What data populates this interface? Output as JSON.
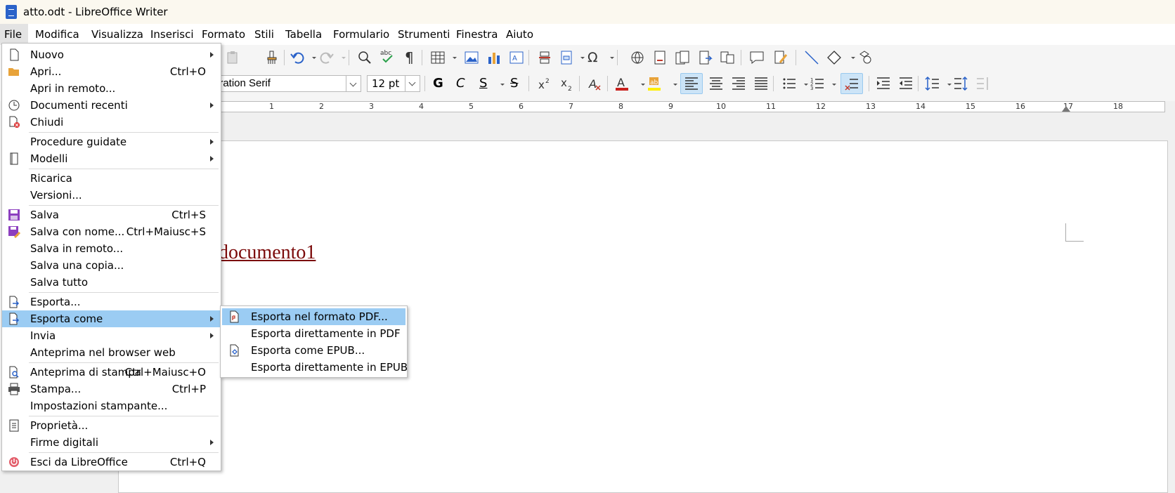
{
  "window": {
    "title": "atto.odt - LibreOffice Writer"
  },
  "menubar": [
    {
      "label": "File",
      "active": true
    },
    {
      "label": "Modifica"
    },
    {
      "label": "Visualizza"
    },
    {
      "label": "Inserisci"
    },
    {
      "label": "Formato"
    },
    {
      "label": "Stili"
    },
    {
      "label": "Tabella"
    },
    {
      "label": "Formulario"
    },
    {
      "label": "Strumenti"
    },
    {
      "label": "Finestra"
    },
    {
      "label": "Aiuto"
    }
  ],
  "formatting": {
    "font_name": "eration Serif",
    "font_size": "12 pt",
    "bold_label": "G",
    "italic_label": "C",
    "underline_label": "S",
    "strike_label": "S"
  },
  "ruler": {
    "numbers": [
      "1",
      "2",
      "3",
      "4",
      "5",
      "6",
      "7",
      "8",
      "9",
      "10",
      "11",
      "12",
      "13",
      "14",
      "15",
      "16",
      "17",
      "18"
    ]
  },
  "document": {
    "text": "documento1"
  },
  "file_menu": [
    {
      "label": "Nuovo",
      "submenu": true,
      "icon": "new-document-icon"
    },
    {
      "label": "Apri...",
      "shortcut": "Ctrl+O",
      "icon": "open-folder-icon"
    },
    {
      "label": "Apri in remoto..."
    },
    {
      "label": "Documenti recenti",
      "submenu": true,
      "icon": "clock-icon"
    },
    {
      "label": "Chiudi",
      "icon": "close-document-icon"
    },
    {
      "label": "Procedure guidate",
      "submenu": true
    },
    {
      "label": "Modelli",
      "submenu": true,
      "icon": "template-icon"
    },
    {
      "label": "Ricarica"
    },
    {
      "label": "Versioni..."
    },
    {
      "label": "Salva",
      "shortcut": "Ctrl+S",
      "icon": "save-icon"
    },
    {
      "label": "Salva con nome...",
      "shortcut": "Ctrl+Maiusc+S",
      "icon": "save-as-icon"
    },
    {
      "label": "Salva in remoto..."
    },
    {
      "label": "Salva una copia..."
    },
    {
      "label": "Salva tutto"
    },
    {
      "label": "Esporta...",
      "icon": "export-icon"
    },
    {
      "label": "Esporta come",
      "submenu": true,
      "highlighted": true,
      "icon": "export-as-icon"
    },
    {
      "label": "Invia",
      "submenu": true
    },
    {
      "label": "Anteprima nel browser web"
    },
    {
      "label": "Anteprima di stampa",
      "shortcut": "Ctrl+Maiusc+O",
      "icon": "print-preview-icon"
    },
    {
      "label": "Stampa...",
      "shortcut": "Ctrl+P",
      "icon": "printer-icon"
    },
    {
      "label": "Impostazioni stampante..."
    },
    {
      "label": "Proprietà...",
      "icon": "properties-icon"
    },
    {
      "label": "Firme digitali",
      "submenu": true
    },
    {
      "label": "Esci da LibreOffice",
      "shortcut": "Ctrl+Q",
      "icon": "exit-icon"
    }
  ],
  "export_submenu": [
    {
      "label": "Esporta nel formato PDF...",
      "highlighted": true,
      "icon": "pdf-icon"
    },
    {
      "label": "Esporta direttamente in PDF"
    },
    {
      "label": "Esporta come EPUB...",
      "icon": "epub-icon"
    },
    {
      "label": "Esporta direttamente in EPUB"
    }
  ]
}
